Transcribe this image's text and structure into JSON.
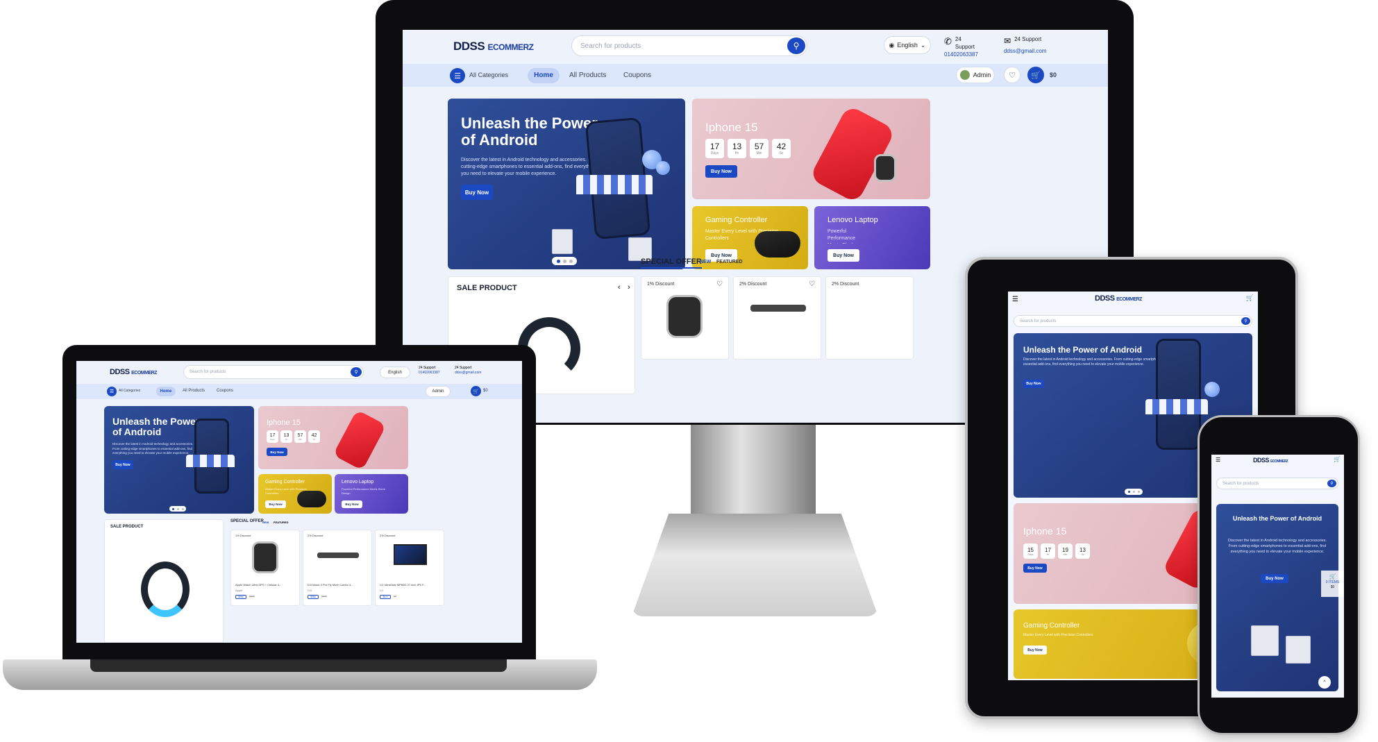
{
  "brand": {
    "logo_main": "DDSS",
    "logo_sub": "ECOMMERZ"
  },
  "search": {
    "placeholder": "Search for products"
  },
  "header": {
    "language": "English",
    "support_label": "24 Support",
    "support_phone": "01402063387",
    "support_email_label": "24 Support",
    "support_email": "ddss@gmail.com"
  },
  "nav": {
    "categories": "All Categories",
    "home": "Home",
    "products": "All Products",
    "coupons": "Coupons",
    "user": "Admin",
    "cart_total": "$0"
  },
  "hero": {
    "title": "Unleash the Power of Android",
    "description": "Discover the latest in Android technology and accessories. From cutting-edge smartphones to essential add-ons, find everything you need to elevate your mobile experience.",
    "button": "Buy Now"
  },
  "promos": {
    "iphone": {
      "title": "Iphone 15",
      "button": "Buy Now",
      "countdown_desktop": [
        {
          "n": "17",
          "u": "Days"
        },
        {
          "n": "13",
          "u": "Hr"
        },
        {
          "n": "57",
          "u": "Min"
        },
        {
          "n": "42",
          "u": "Sc"
        }
      ],
      "countdown_tablet": [
        {
          "n": "15",
          "u": "Days"
        },
        {
          "n": "17",
          "u": "Hr"
        },
        {
          "n": "19",
          "u": "Min"
        },
        {
          "n": "13",
          "u": "Sc"
        }
      ]
    },
    "gaming": {
      "title": "Gaming Controller",
      "subtitle": "Master Every Level with Precision Controllers",
      "button": "Buy Now"
    },
    "lenovo": {
      "title": "Lenovo Laptop",
      "subtitle": "Powerful Performance Meets Sleek Design",
      "button": "Buy Now"
    }
  },
  "sections": {
    "sale": "SALE PRODUCT",
    "special": "SPECIAL OFFER",
    "tab_new": "NEW",
    "tab_featured": "FEATURED"
  },
  "products": [
    {
      "discount": "1% Discount",
      "name": "Apple Watch Ultra GPS + Cellular 4...",
      "brand": "Apple",
      "price": "$990",
      "old": "$999"
    },
    {
      "discount": "2% Discount",
      "name": "DJI Mavic 3 Pro Fly More Combo 4...",
      "brand": "DJI",
      "price": "$980",
      "old": "$999"
    },
    {
      "discount": "2% Discount",
      "name": "LG UltraGear MP60G 27 inch IPS F...",
      "brand": "LG",
      "price": "$4.9",
      "old": "$5"
    }
  ],
  "mobile": {
    "hero_title": "Unleash the Power of Android",
    "hero_desc": "Discover the latest in Android technology and accessories. From cutting-edge smartphones to essential add-ons, find everything you need to elevate your mobile experience.",
    "cart_items": "0 ITEMS",
    "cart_total": "$0"
  },
  "colors": {
    "primary": "#1b49c3",
    "nav_bg": "#dde7fb",
    "hero_bg": "#2b4a95"
  }
}
